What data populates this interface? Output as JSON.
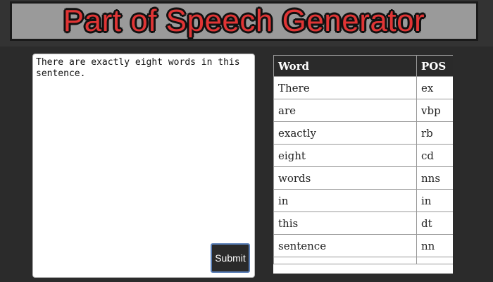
{
  "header": {
    "title": "Part of Speech Generator"
  },
  "input": {
    "value": "There are exactly eight words in this sentence."
  },
  "submit": {
    "label": "Submit"
  },
  "table": {
    "headers": [
      "Word",
      "POS"
    ],
    "rows": [
      [
        "There",
        "ex"
      ],
      [
        "are",
        "vbp"
      ],
      [
        "exactly",
        "rb"
      ],
      [
        "eight",
        "cd"
      ],
      [
        "words",
        "nns"
      ],
      [
        "in",
        "in"
      ],
      [
        "this",
        "dt"
      ],
      [
        "sentence",
        "nn"
      ]
    ]
  },
  "colors": {
    "background": "#2b2b2b",
    "title_bar": "#9a9a9a",
    "title_text": "#e03535",
    "button_bg": "#2a2a2a",
    "button_border": "#5a7fb8",
    "table_header_bg": "#2a2a2a"
  }
}
